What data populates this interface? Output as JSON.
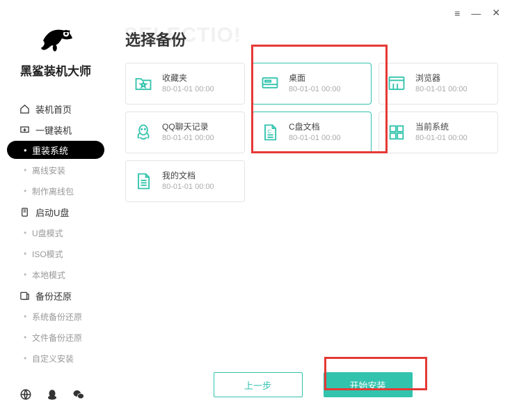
{
  "app": {
    "name": "黑鲨装机大师",
    "bg_text": "SELECTIO!"
  },
  "nav": {
    "items": [
      {
        "label": "装机首页",
        "type": "main"
      },
      {
        "label": "一键装机",
        "type": "main"
      },
      {
        "label": "重装系统",
        "type": "sub_active"
      },
      {
        "label": "离线安装",
        "type": "sub"
      },
      {
        "label": "制作离线包",
        "type": "sub"
      },
      {
        "label": "启动U盘",
        "type": "main"
      },
      {
        "label": "U盘模式",
        "type": "sub"
      },
      {
        "label": "ISO模式",
        "type": "sub"
      },
      {
        "label": "本地模式",
        "type": "sub"
      },
      {
        "label": "备份还原",
        "type": "main"
      },
      {
        "label": "系统备份还原",
        "type": "sub"
      },
      {
        "label": "文件备份还原",
        "type": "sub"
      },
      {
        "label": "自定义安装",
        "type": "sub"
      }
    ]
  },
  "page": {
    "title": "选择备份"
  },
  "cards": [
    {
      "title": "收藏夹",
      "date": "80-01-01 00:00",
      "selected": false,
      "icon": "folder-star"
    },
    {
      "title": "桌面",
      "date": "80-01-01 00:00",
      "selected": true,
      "icon": "desktop"
    },
    {
      "title": "浏览器",
      "date": "80-01-01 00:00",
      "selected": false,
      "icon": "browser"
    },
    {
      "title": "QQ聊天记录",
      "date": "80-01-01 00:00",
      "selected": false,
      "icon": "qq"
    },
    {
      "title": "C盘文档",
      "date": "80-01-01 00:00",
      "selected": true,
      "icon": "doc-c"
    },
    {
      "title": "当前系统",
      "date": "80-01-01 00:00",
      "selected": false,
      "icon": "grid"
    },
    {
      "title": "我的文档",
      "date": "80-01-01 00:00",
      "selected": false,
      "icon": "doc"
    }
  ],
  "buttons": {
    "back": "上一步",
    "start": "开始安装"
  },
  "colors": {
    "accent": "#32c3ad",
    "highlight": "#e53935"
  }
}
